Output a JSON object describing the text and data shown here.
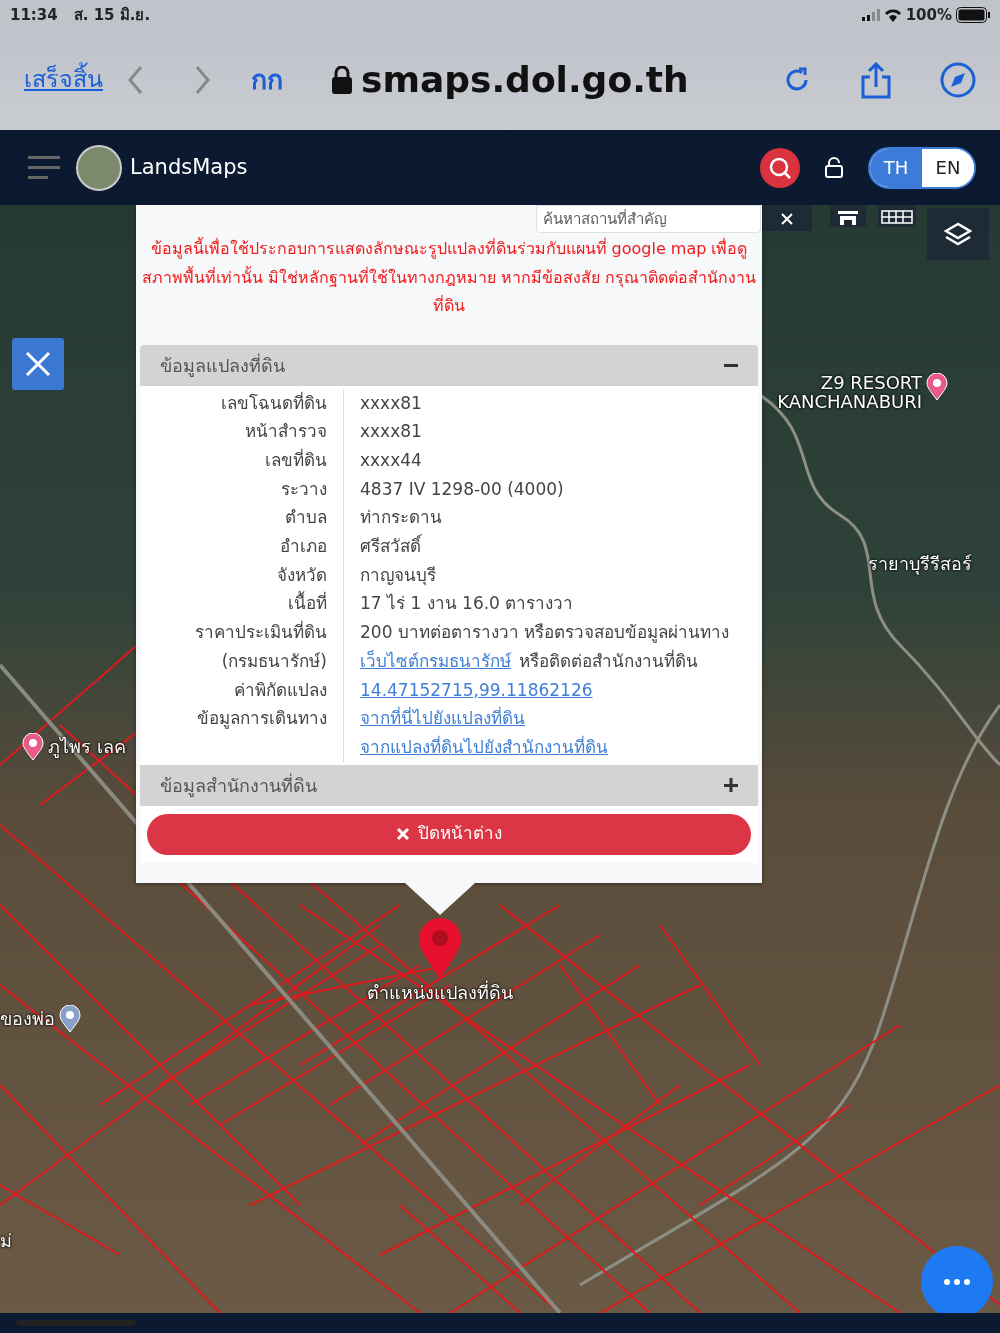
{
  "status_bar": {
    "time": "11:34",
    "date": "ส. 15 มิ.ย.",
    "battery": "100%"
  },
  "browser": {
    "done": "เสร็จสิ้น",
    "text_size": "กก",
    "url": "smaps.dol.go.th"
  },
  "app": {
    "title": "LandsMaps",
    "languages": [
      {
        "label": "TH",
        "selected": true
      },
      {
        "label": "EN",
        "selected": false
      }
    ]
  },
  "map_search": {
    "placeholder": "ค้นหาสถานที่สำคัญ"
  },
  "popup": {
    "notice": "ข้อมูลนี้เพื่อใช้ประกอบการแสดงลักษณะรูปแปลงที่ดินร่วมกับแผนที่ google map เพื่อดูสภาพพื้นที่เท่านั้น มิใช่หลักฐานที่ใช้ในทางกฎหมาย หากมีข้อสงสัย กรุณาติดต่อสำนักงานที่ดิน",
    "sections": [
      {
        "title": "ข้อมูลแปลงที่ดิน",
        "expanded": true,
        "rows": [
          {
            "labels": [
              "เลขโฉนดที่ดิน"
            ],
            "lines": [
              [
                {
                  "kind": "text",
                  "text": "xxxx81"
                }
              ]
            ]
          },
          {
            "labels": [
              "หน้าสำรวจ"
            ],
            "lines": [
              [
                {
                  "kind": "text",
                  "text": "xxxx81"
                }
              ]
            ]
          },
          {
            "labels": [
              "เลขที่ดิน"
            ],
            "lines": [
              [
                {
                  "kind": "text",
                  "text": "xxxx44"
                }
              ]
            ]
          },
          {
            "labels": [
              "ระวาง"
            ],
            "lines": [
              [
                {
                  "kind": "text",
                  "text": "4837 IV 1298-00 (4000)"
                }
              ]
            ]
          },
          {
            "labels": [
              "ตำบล"
            ],
            "lines": [
              [
                {
                  "kind": "text",
                  "text": "ท่ากระดาน"
                }
              ]
            ]
          },
          {
            "labels": [
              "อำเภอ"
            ],
            "lines": [
              [
                {
                  "kind": "text",
                  "text": "ศรีสวัสดิ์"
                }
              ]
            ]
          },
          {
            "labels": [
              "จังหวัด"
            ],
            "lines": [
              [
                {
                  "kind": "text",
                  "text": "กาญจนบุรี"
                }
              ]
            ]
          },
          {
            "labels": [
              "เนื้อที่"
            ],
            "lines": [
              [
                {
                  "kind": "text",
                  "text": "17 ไร่ 1 งาน 16.0 ตารางวา"
                }
              ]
            ]
          },
          {
            "labels": [
              "ราคาประเมินที่ดิน",
              "(กรมธนารักษ์)"
            ],
            "lines": [
              [
                {
                  "kind": "text",
                  "text": "200 บาทต่อตารางวา หรือตรวจสอบข้อมูลผ่านทาง"
                }
              ],
              [
                {
                  "kind": "link",
                  "text": "เว็บไซต์กรมธนารักษ์"
                },
                {
                  "kind": "text",
                  "text": "หรือติดต่อสำนักงานที่ดิน"
                }
              ]
            ]
          },
          {
            "labels": [
              "ค่าพิกัดแปลง"
            ],
            "lines": [
              [
                {
                  "kind": "link",
                  "text": "14.47152715,99.11862126"
                }
              ]
            ]
          },
          {
            "labels": [
              "ข้อมูลการเดินทาง"
            ],
            "lines": [
              [
                {
                  "kind": "link",
                  "text": "จากที่นี่ไปยังแปลงที่ดิน"
                }
              ],
              [
                {
                  "kind": "link",
                  "text": "จากแปลงที่ดินไปยังสำนักงานที่ดิน"
                }
              ]
            ]
          }
        ]
      },
      {
        "title": "ข้อมูลสำนักงานที่ดิน",
        "expanded": false
      }
    ],
    "close_button": "ปิดหน้าต่าง"
  },
  "map": {
    "marker_label": "ตำแหน่งแปลงที่ดิน",
    "places": [
      {
        "text": "Z9 RESORT KANCHANABURI",
        "kind": "pin"
      },
      {
        "text": "รายาบุรีรีสอร์",
        "kind": "plain"
      },
      {
        "text": "ภูไพร เลค",
        "kind": "pin"
      },
      {
        "text": "ของพ่อ",
        "kind": "pin"
      },
      {
        "text": "ม่",
        "kind": "plain"
      }
    ]
  }
}
